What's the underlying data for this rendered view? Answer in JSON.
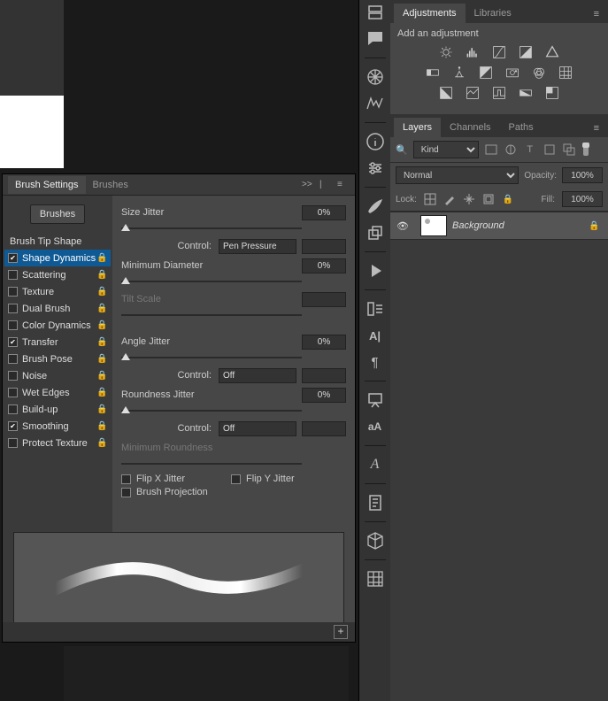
{
  "brush_panel": {
    "tabs": {
      "settings": "Brush Settings",
      "brushes": "Brushes"
    },
    "brushes_button": "Brushes",
    "sidebar": {
      "brush_tip_shape": "Brush Tip Shape",
      "items": [
        {
          "label": "Shape Dynamics",
          "checked": true,
          "selected": true
        },
        {
          "label": "Scattering",
          "checked": false
        },
        {
          "label": "Texture",
          "checked": false
        },
        {
          "label": "Dual Brush",
          "checked": false
        },
        {
          "label": "Color Dynamics",
          "checked": false
        },
        {
          "label": "Transfer",
          "checked": true
        },
        {
          "label": "Brush Pose",
          "checked": false
        },
        {
          "label": "Noise",
          "checked": false
        },
        {
          "label": "Wet Edges",
          "checked": false
        },
        {
          "label": "Build-up",
          "checked": false
        },
        {
          "label": "Smoothing",
          "checked": true
        },
        {
          "label": "Protect Texture",
          "checked": false
        }
      ]
    },
    "controls": {
      "size_jitter": {
        "label": "Size Jitter",
        "value": "0%"
      },
      "size_control": {
        "label": "Control:",
        "selected": "Pen Pressure",
        "extra": ""
      },
      "min_diameter": {
        "label": "Minimum Diameter",
        "value": "0%"
      },
      "tilt_scale": {
        "label": "Tilt Scale",
        "value": ""
      },
      "angle_jitter": {
        "label": "Angle Jitter",
        "value": "0%"
      },
      "angle_control": {
        "label": "Control:",
        "selected": "Off",
        "extra": ""
      },
      "roundness_jitter": {
        "label": "Roundness Jitter",
        "value": "0%"
      },
      "round_control": {
        "label": "Control:",
        "selected": "Off",
        "extra": ""
      },
      "min_roundness": {
        "label": "Minimum Roundness",
        "value": ""
      },
      "flip_x": "Flip X Jitter",
      "flip_y": "Flip Y Jitter",
      "brush_projection": "Brush Projection"
    }
  },
  "right": {
    "adjustments": {
      "tabs": {
        "adjustments": "Adjustments",
        "libraries": "Libraries"
      },
      "title": "Add an adjustment",
      "icons_r1": [
        "brightness-contrast-icon",
        "levels-icon",
        "curves-icon",
        "exposure-icon",
        "vibrance-icon"
      ],
      "icons_r2": [
        "hue-sat-icon",
        "color-balance-icon",
        "black-white-icon",
        "photo-filter-icon",
        "channel-mixer-icon",
        "color-lookup-icon"
      ],
      "icons_r3": [
        "invert-icon",
        "posterize-icon",
        "threshold-icon",
        "gradient-map-icon",
        "selective-color-icon"
      ]
    },
    "layers": {
      "tabs": {
        "layers": "Layers",
        "channels": "Channels",
        "paths": "Paths"
      },
      "filter_kind": "Kind",
      "blend_mode": "Normal",
      "opacity_label": "Opacity:",
      "opacity_value": "100%",
      "lock_label": "Lock:",
      "fill_label": "Fill:",
      "fill_value": "100%",
      "layer": {
        "name": "Background"
      }
    }
  },
  "glyphs": {
    "collapse": ">>",
    "pipe": "|",
    "menu": "≡",
    "lock": "🔒",
    "check": "✔",
    "plus": "+",
    "eye": "👁",
    "search": "🔍"
  }
}
